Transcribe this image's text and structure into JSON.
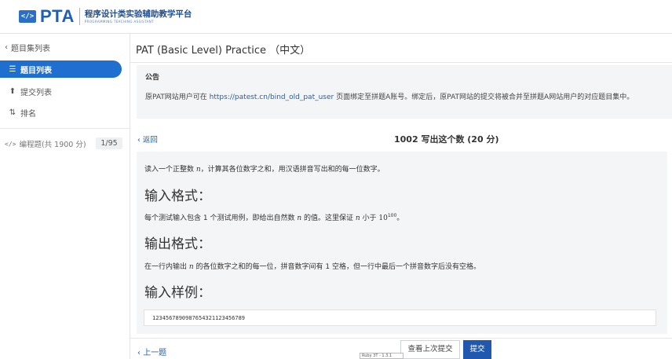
{
  "brand": {
    "name": "PTA",
    "subtitle": "程序设计类实验辅助教学平台",
    "subtitle_en": "PROGRAMMING TEACHING ASSISTANT",
    "logo_mark": "</>"
  },
  "sidebar": {
    "back_label": "题目集列表",
    "items": [
      {
        "label": "题目列表",
        "icon": "list-icon",
        "active": true
      },
      {
        "label": "提交列表",
        "icon": "upload-icon",
        "active": false
      },
      {
        "label": "排名",
        "icon": "sort-icon",
        "active": false
      }
    ],
    "problem_set": {
      "label": "编程题(共 1900 分)",
      "count": "1/95"
    }
  },
  "main": {
    "title": "PAT (Basic Level) Practice （中文）",
    "notice": {
      "heading": "公告",
      "text_before": "原PAT网站用户可在 ",
      "link": "https://patest.cn/bind_old_pat_user",
      "text_after": " 页面绑定至拼题A账号。绑定后，原PAT网站的提交将被合并至拼题A网站用户的对应题目集中。"
    },
    "back_label": "返回",
    "problem_title": "1002 写出这个数 (20 分)",
    "description_a": "读入一个正整数 ",
    "description_var": "n",
    "description_b": "，计算其各位数字之和，用汉语拼音写出和的每一位数字。",
    "input_heading": "输入格式：",
    "input_text_a": "每个测试输入包含 1 个测试用例，即给出自然数 ",
    "input_text_var": "n",
    "input_text_b": " 的值。这里保证 ",
    "input_text_var2": "n",
    "input_text_c": " 小于 ",
    "input_pow_base": "10",
    "input_pow_exp": "100",
    "input_text_d": "。",
    "output_heading": "输出格式：",
    "output_text_a": "在一行内输出 ",
    "output_text_var": "n",
    "output_text_b": " 的各位数字之和的每一位，拼音数字间有 1 空格，但一行中最后一个拼音数字后没有空格。",
    "sample_heading": "输入样例：",
    "sample_input": "1234567890987654321123456789",
    "prev_label": "上一题",
    "last_submit_label": "查看上次提交",
    "submit_label": "提交",
    "tooltip": "Ruby 3T - 1.3.1"
  }
}
